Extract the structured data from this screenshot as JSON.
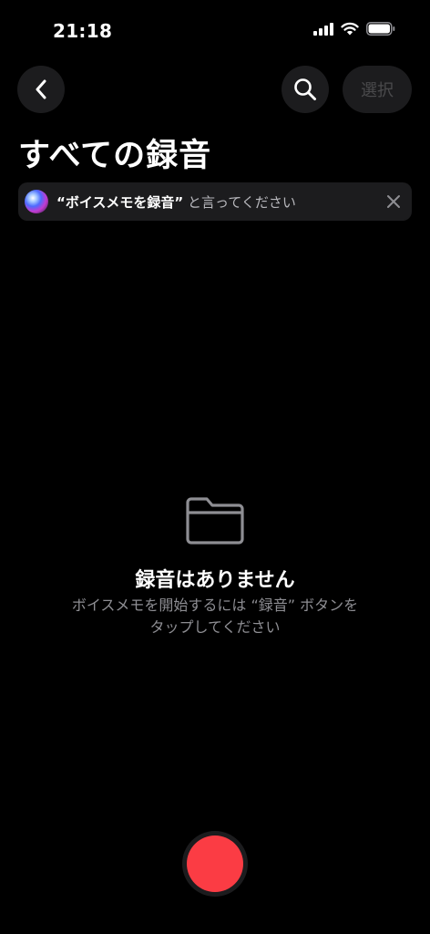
{
  "status_bar": {
    "time": "21:18"
  },
  "nav": {
    "back_icon": "chevron-left-icon",
    "search_icon": "search-icon",
    "select_label": "選択"
  },
  "page": {
    "title": "すべての録音"
  },
  "siri_banner": {
    "phrase": "“ボイスメモを録音”",
    "suffix": " と言ってください"
  },
  "empty_state": {
    "icon": "folder-icon",
    "title": "録音はありません",
    "line1": "ボイスメモを開始するには “録音” ボタンを",
    "line2": "タップしてください"
  },
  "record": {
    "color": "#fb3c44"
  },
  "colors": {
    "background": "#000000",
    "surface": "#1c1c1e",
    "secondary_text": "#8e8e93"
  }
}
